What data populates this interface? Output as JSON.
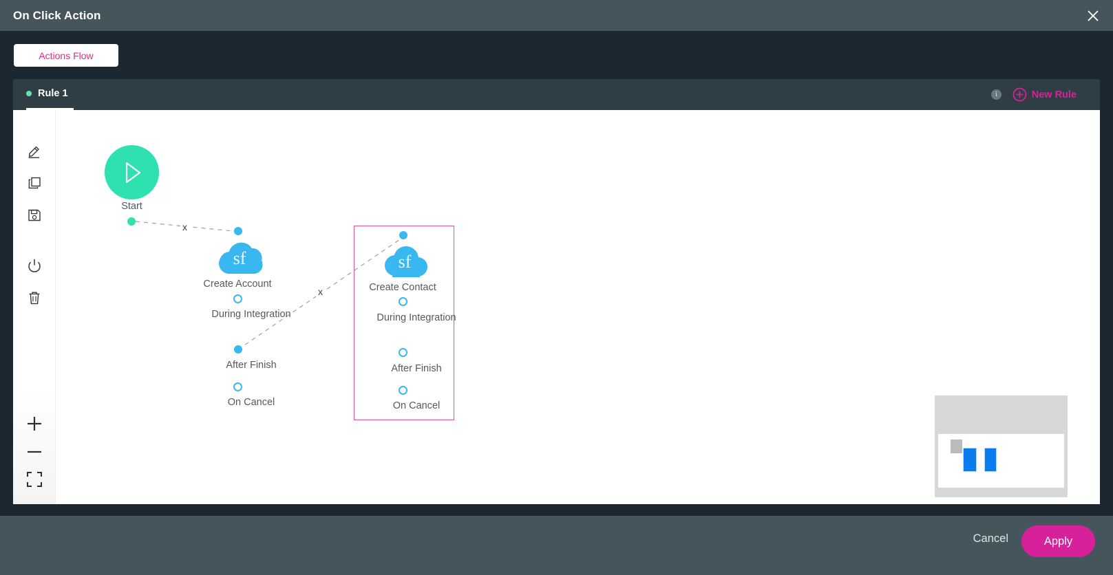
{
  "window": {
    "title": "On Click Action",
    "close_icon": "close-icon"
  },
  "tabstrip": {
    "flow_tab_label": "Actions Flow"
  },
  "rulebar": {
    "rule_label": "Rule 1",
    "info_badge": "i",
    "new_rule_label": "New Rule",
    "accent_color": "#d6219b",
    "status_dot_color": "#66e3ab"
  },
  "toolrail": {
    "tools": [
      {
        "name": "edit-icon",
        "title": "Edit"
      },
      {
        "name": "copy-icon",
        "title": "Copy"
      },
      {
        "name": "save-icon",
        "title": "Save"
      },
      {
        "name": "power-icon",
        "title": "Enable / Disable"
      },
      {
        "name": "trash-icon",
        "title": "Delete"
      },
      {
        "name": "zoom-in-icon",
        "title": "Zoom In"
      },
      {
        "name": "zoom-out-icon",
        "title": "Zoom Out"
      },
      {
        "name": "fit-screen-icon",
        "title": "Fit to Screen"
      }
    ]
  },
  "flow": {
    "start_node": {
      "label": "Start",
      "icon": "play-icon",
      "color": "#2fe0b0"
    },
    "nodes": [
      {
        "label": "Create Account",
        "icon": "salesforce-cloud-icon",
        "icon_text": "sf",
        "color": "#39b7f0",
        "selected": false,
        "ports": [
          {
            "label": "During Integration",
            "state": "hollow"
          },
          {
            "label": "After Finish",
            "state": "filled"
          },
          {
            "label": "On Cancel",
            "state": "hollow"
          }
        ]
      },
      {
        "label": "Create Contact",
        "icon": "salesforce-cloud-icon",
        "icon_text": "sf",
        "color": "#39b7f0",
        "selected": true,
        "ports": [
          {
            "label": "During Integration",
            "state": "hollow"
          },
          {
            "label": "After Finish",
            "state": "hollow"
          },
          {
            "label": "On Cancel",
            "state": "hollow"
          }
        ]
      }
    ],
    "edges": [
      {
        "from": "Start",
        "to": "Create Account",
        "delete_label": "x"
      },
      {
        "from": "Create Account / After Finish",
        "to": "Create Contact",
        "delete_label": "x"
      }
    ]
  },
  "minimap": {
    "name": "minimap"
  },
  "footer": {
    "cancel_label": "Cancel",
    "apply_label": "Apply",
    "apply_color": "#d6219b"
  }
}
